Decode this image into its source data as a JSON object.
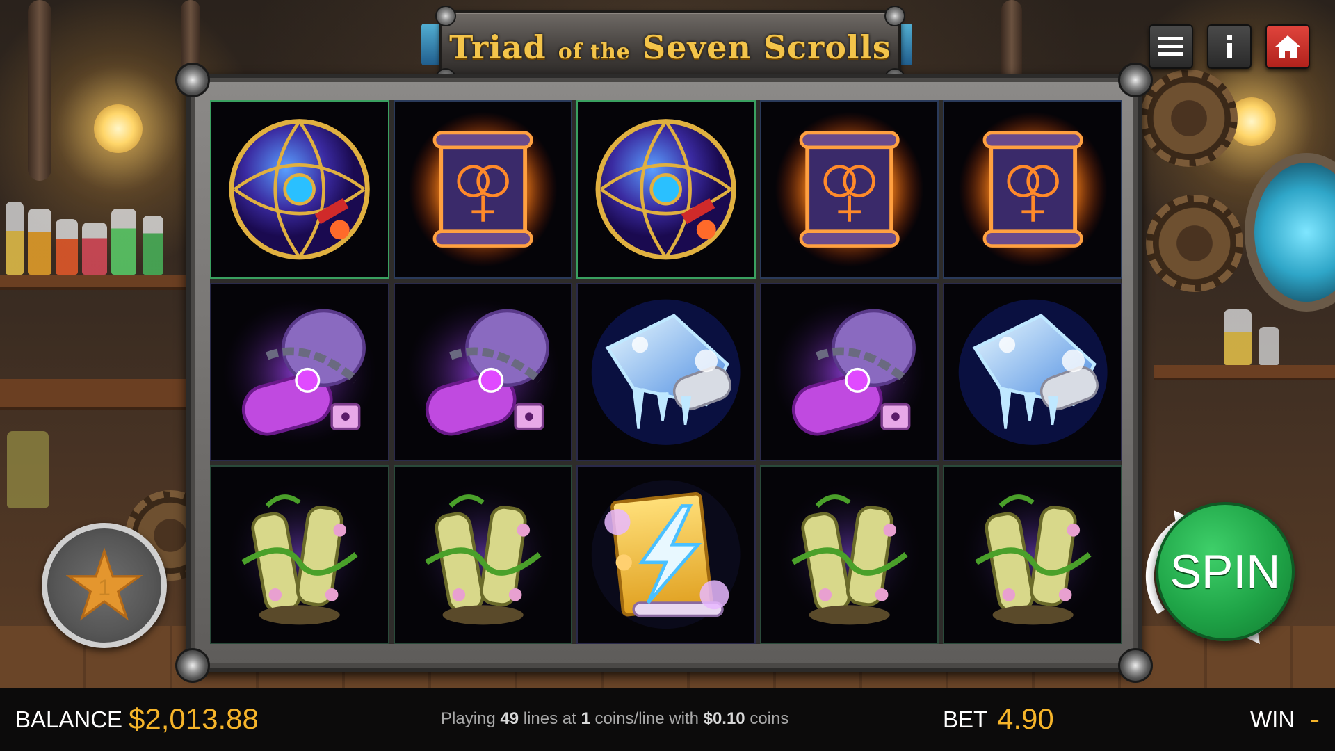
{
  "game": {
    "title_part1": "Triad",
    "title_part2": "of the",
    "title_part3": "Seven Scrolls"
  },
  "top_buttons": [
    {
      "name": "menu",
      "icon": "hamburger-menu-icon"
    },
    {
      "name": "info",
      "icon": "info-icon"
    },
    {
      "name": "home",
      "icon": "home-icon"
    }
  ],
  "reels": {
    "rows": [
      [
        "rune-orb",
        "fire-scroll",
        "rune-orb",
        "fire-scroll",
        "fire-scroll"
      ],
      [
        "chained-scroll",
        "chained-scroll",
        "ice-scroll",
        "chained-scroll",
        "ice-scroll"
      ],
      [
        "vine-scroll",
        "vine-scroll",
        "lightning-scroll",
        "vine-scroll",
        "vine-scroll"
      ]
    ]
  },
  "favorite": {
    "icon": "star-icon",
    "count": "1"
  },
  "spin": {
    "label": "SPIN"
  },
  "status": {
    "balance_label": "BALANCE",
    "balance_value": "$2,013.88",
    "info_playing": "Playing",
    "info_lines": "49",
    "info_lines_at": "lines at",
    "info_coins": "1",
    "info_coins_line_with": "coins/line with",
    "info_coin_value": "$0.10",
    "info_coins_word": "coins",
    "bet_label": "BET",
    "bet_value": "4.90",
    "win_label": "WIN",
    "win_value": "-"
  },
  "colors": {
    "accent_gold": "#f5b42a",
    "spin_green": "#1fa447",
    "home_red": "#d0332c"
  }
}
